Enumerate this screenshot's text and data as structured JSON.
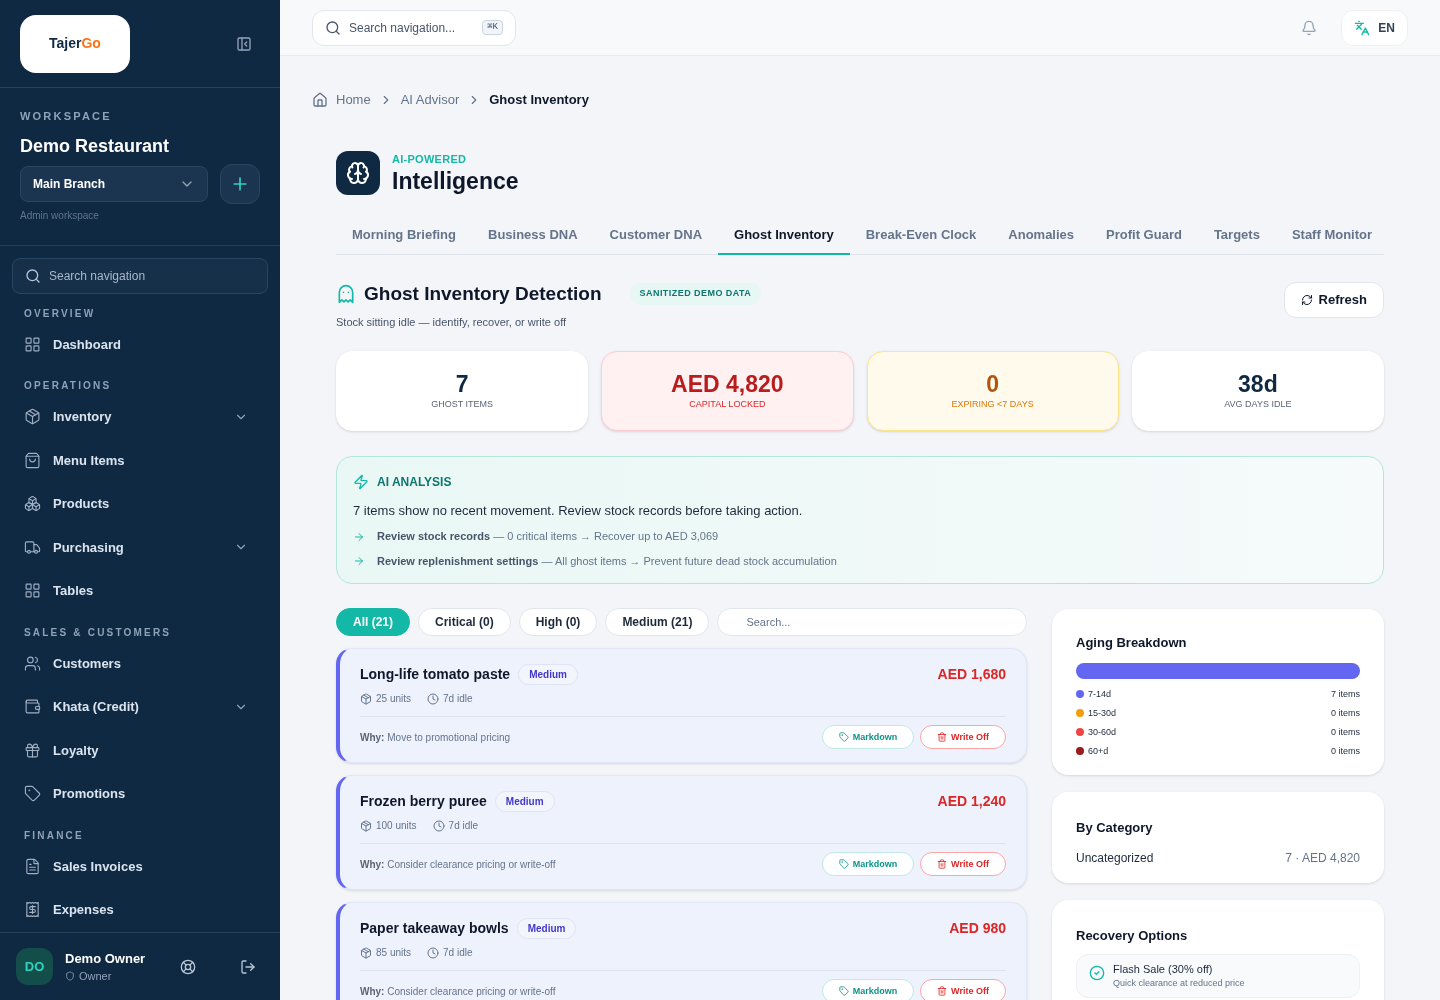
{
  "sidebar": {
    "logo": {
      "part1": "Tajer",
      "part2": "Go"
    },
    "workspace_label": "WORKSPACE",
    "workspace_name": "Demo Restaurant",
    "branch": "Main Branch",
    "workspace_note": "Admin workspace",
    "search": {
      "placeholder": "Search navigation"
    },
    "sections": [
      {
        "title": "OVERVIEW",
        "items": [
          {
            "label": "Dashboard",
            "expandable": false
          }
        ]
      },
      {
        "title": "OPERATIONS",
        "items": [
          {
            "label": "Inventory",
            "expandable": true
          },
          {
            "label": "Menu Items",
            "expandable": false
          },
          {
            "label": "Products",
            "expandable": false
          },
          {
            "label": "Purchasing",
            "expandable": true
          },
          {
            "label": "Tables",
            "expandable": false
          }
        ]
      },
      {
        "title": "SALES & CUSTOMERS",
        "items": [
          {
            "label": "Customers",
            "expandable": false
          },
          {
            "label": "Khata (Credit)",
            "expandable": true
          },
          {
            "label": "Loyalty",
            "expandable": false
          },
          {
            "label": "Promotions",
            "expandable": false
          }
        ]
      },
      {
        "title": "FINANCE",
        "items": [
          {
            "label": "Sales Invoices",
            "expandable": false
          },
          {
            "label": "Expenses",
            "expandable": false
          }
        ]
      }
    ],
    "user": {
      "initials": "DO",
      "name": "Demo Owner",
      "role": "Owner"
    }
  },
  "topbar": {
    "search": {
      "placeholder": "Search navigation...",
      "shortcut": "⌘K"
    },
    "language": "EN"
  },
  "breadcrumb": [
    "Home",
    "AI Advisor",
    "Ghost Inventory"
  ],
  "header": {
    "eyebrow": "AI-POWERED",
    "title": "Intelligence"
  },
  "tabs": [
    {
      "label": "Morning Briefing",
      "selected": false
    },
    {
      "label": "Business DNA",
      "selected": false
    },
    {
      "label": "Customer DNA",
      "selected": false
    },
    {
      "label": "Ghost Inventory",
      "selected": true
    },
    {
      "label": "Break-Even Clock",
      "selected": false
    },
    {
      "label": "Anomalies",
      "selected": false
    },
    {
      "label": "Profit Guard",
      "selected": false
    },
    {
      "label": "Targets",
      "selected": false
    },
    {
      "label": "Staff Monitor",
      "selected": false
    }
  ],
  "section": {
    "title": "Ghost Inventory Detection",
    "badge": "SANITIZED DEMO DATA",
    "subtitle": "Stock sitting idle — identify, recover, or write off",
    "refresh": "Refresh"
  },
  "stats": [
    {
      "value": "7",
      "label": "GHOST ITEMS"
    },
    {
      "value": "AED 4,820",
      "label": "CAPITAL LOCKED"
    },
    {
      "value": "0",
      "label": "EXPIRING <7 DAYS"
    },
    {
      "value": "38d",
      "label": "AVG DAYS IDLE"
    }
  ],
  "analysis": {
    "title": "AI ANALYSIS",
    "summary": "7 items show no recent movement. Review stock records before taking action.",
    "actions": [
      "**Review stock records** — 0 critical items → Recover up to AED 3,069",
      "**Review replenishment settings** — All ghost items → Prevent future dead stock accumulation"
    ]
  },
  "filters": [
    {
      "label": "All (21)",
      "selected": true
    },
    {
      "label": "Critical (0)",
      "selected": false
    },
    {
      "label": "High (0)",
      "selected": false
    },
    {
      "label": "Medium (21)",
      "selected": false
    }
  ],
  "filter_search": {
    "placeholder": "Search..."
  },
  "items": [
    {
      "name": "Long-life tomato paste",
      "severity": "Medium",
      "value": "AED 1,680",
      "units": "25 units",
      "idle": "7d idle",
      "why_label": "Why:",
      "why": "Move to promotional pricing",
      "markdown": "Markdown",
      "write_off": "Write Off"
    },
    {
      "name": "Frozen berry puree",
      "severity": "Medium",
      "value": "AED 1,240",
      "units": "100 units",
      "idle": "7d idle",
      "why_label": "Why:",
      "why": "Consider clearance pricing or write-off",
      "markdown": "Markdown",
      "write_off": "Write Off"
    },
    {
      "name": "Paper takeaway bowls",
      "severity": "Medium",
      "value": "AED 980",
      "units": "85 units",
      "idle": "7d idle",
      "why_label": "Why:",
      "why": "Consider clearance pricing or write-off",
      "markdown": "Markdown",
      "write_off": "Write Off"
    }
  ],
  "aging": {
    "title": "Aging Breakdown",
    "buckets": [
      {
        "label": "7-14d",
        "count": "7 items",
        "color": "#6366f1",
        "level": 1
      },
      {
        "label": "15-30d",
        "count": "0 items",
        "color": "#f59e0b",
        "level": 0
      },
      {
        "label": "30-60d",
        "count": "0 items",
        "color": "#ef4444",
        "level": 0
      },
      {
        "label": "60+d",
        "count": "0 items",
        "color": "#991b1b",
        "level": 0
      }
    ]
  },
  "categories": {
    "title": "By Category",
    "rows": [
      {
        "name": "Uncategorized",
        "summary": "7 · AED 4,820"
      }
    ]
  },
  "recovery": {
    "title": "Recovery Options",
    "options": [
      {
        "title": "Flash Sale (30% off)",
        "description": "Quick clearance at reduced price"
      }
    ]
  }
}
